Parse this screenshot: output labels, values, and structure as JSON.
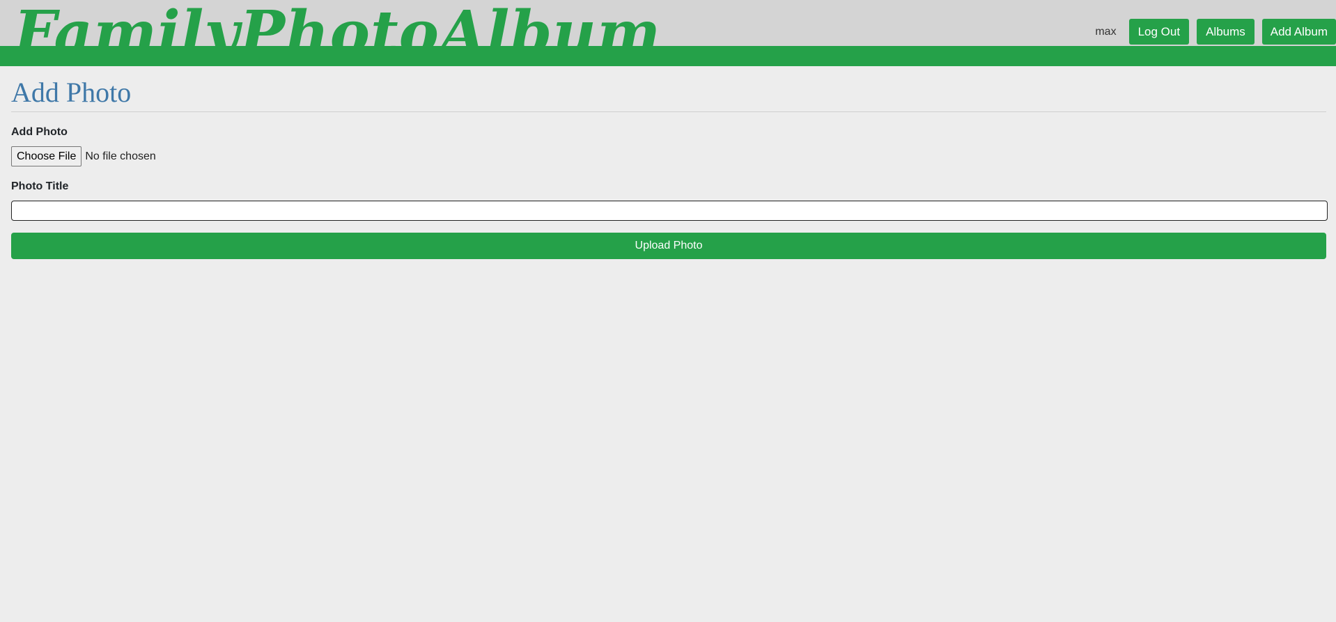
{
  "header": {
    "brand": "FamilyPhotoAlbum",
    "username": "max",
    "logout_label": "Log Out",
    "albums_label": "Albums",
    "add_album_label": "Add Album"
  },
  "main": {
    "page_title": "Add Photo",
    "add_photo_label": "Add Photo",
    "file_button_label": "Choose File",
    "file_status": "No file chosen",
    "photo_title_label": "Photo Title",
    "photo_title_value": "",
    "upload_label": "Upload Photo"
  },
  "colors": {
    "accent": "#25a149",
    "title": "#3f78a8",
    "background": "#ededed",
    "header_background": "#d4d4d4"
  }
}
